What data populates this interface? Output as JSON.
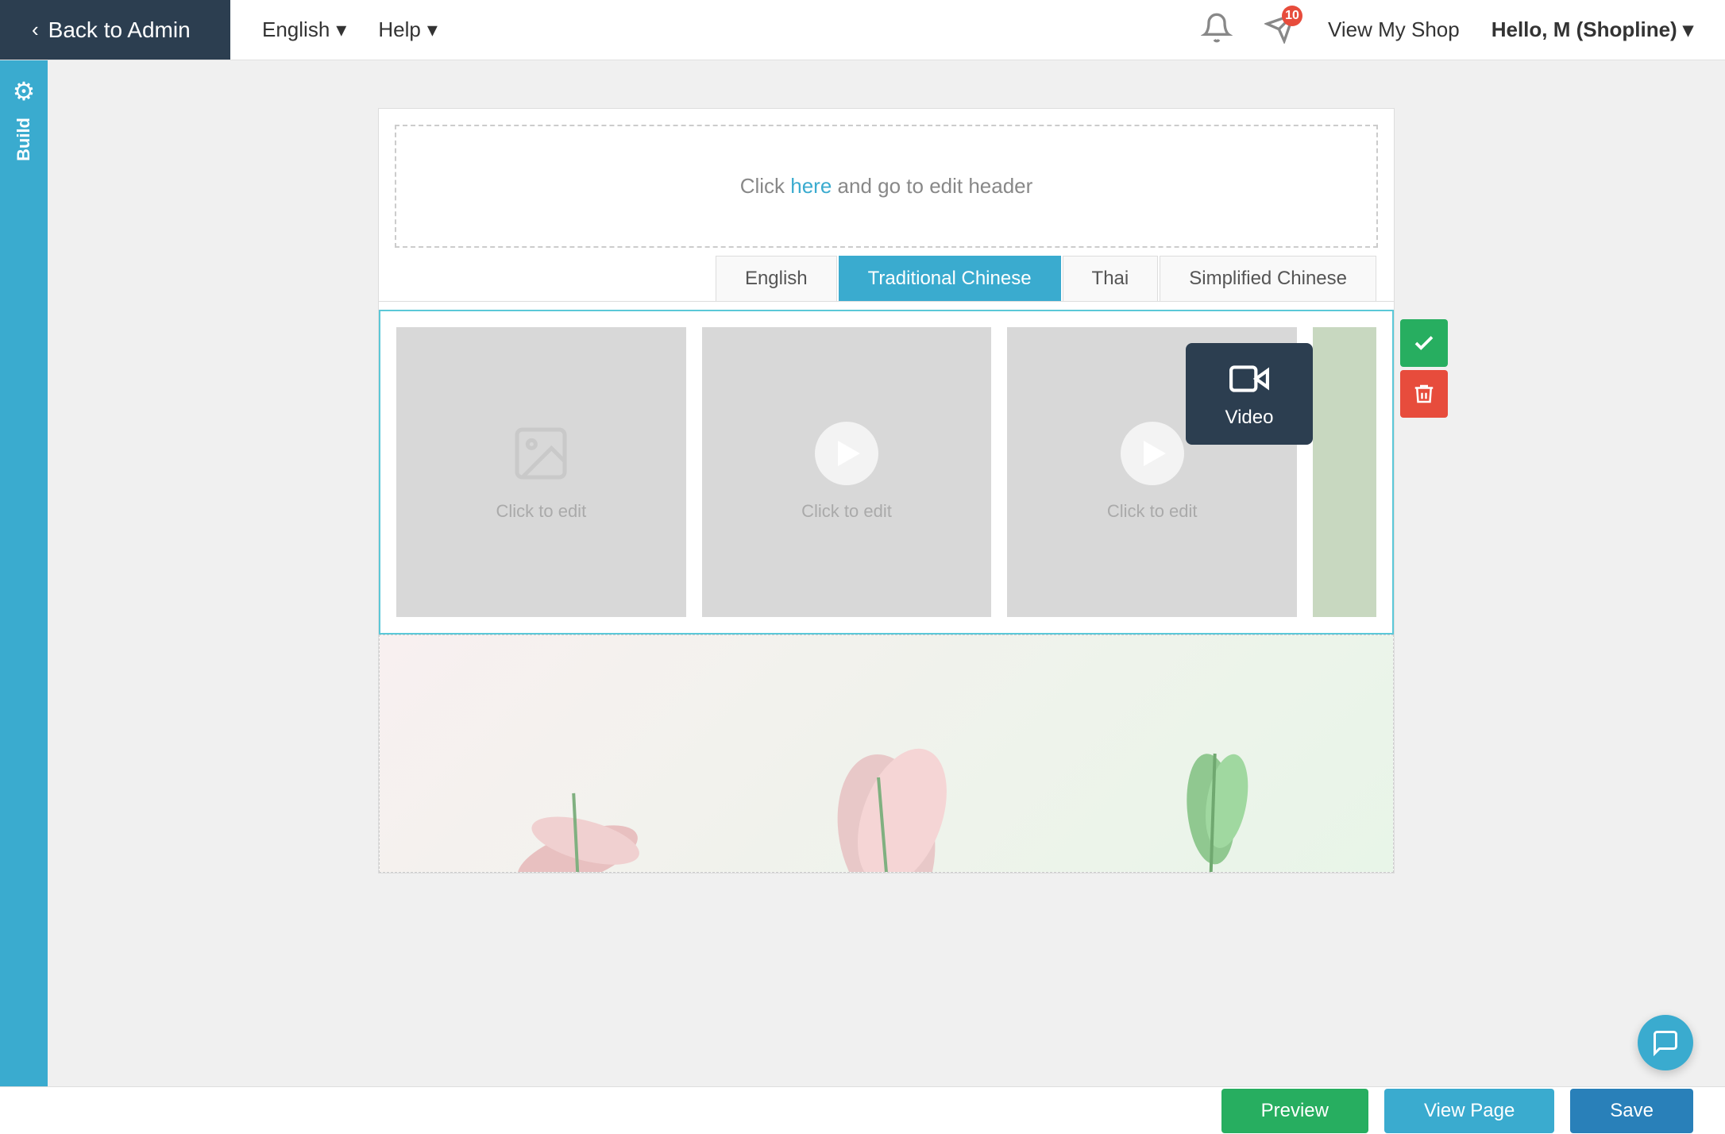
{
  "header": {
    "back_label": "Back to Admin",
    "language_label": "English",
    "language_arrow": "▾",
    "help_label": "Help",
    "help_arrow": "▾",
    "notification_count": "10",
    "view_shop_label": "View My Shop",
    "hello_prefix": "Hello, ",
    "hello_user": "M (Shopline)",
    "hello_arrow": "▾"
  },
  "sidebar": {
    "build_label": "Build",
    "build_icon": "⚡"
  },
  "page_builder": {
    "header_text_before": "Click ",
    "header_link": "here",
    "header_text_after": " and go to edit header",
    "lang_tabs": [
      {
        "label": "English",
        "active": false
      },
      {
        "label": "Traditional Chinese",
        "active": true
      },
      {
        "label": "Thai",
        "active": false
      },
      {
        "label": "Simplified Chinese",
        "active": false
      }
    ],
    "media_items": [
      {
        "type": "image",
        "label": "Click to edit"
      },
      {
        "type": "video",
        "label": "Click to edit"
      },
      {
        "type": "video",
        "label": "Click to edit"
      }
    ],
    "video_tooltip": "Video"
  },
  "footer": {
    "preview_label": "Preview",
    "view_page_label": "View Page",
    "save_label": "Save"
  },
  "actions": {
    "confirm_title": "confirm",
    "delete_title": "delete"
  }
}
